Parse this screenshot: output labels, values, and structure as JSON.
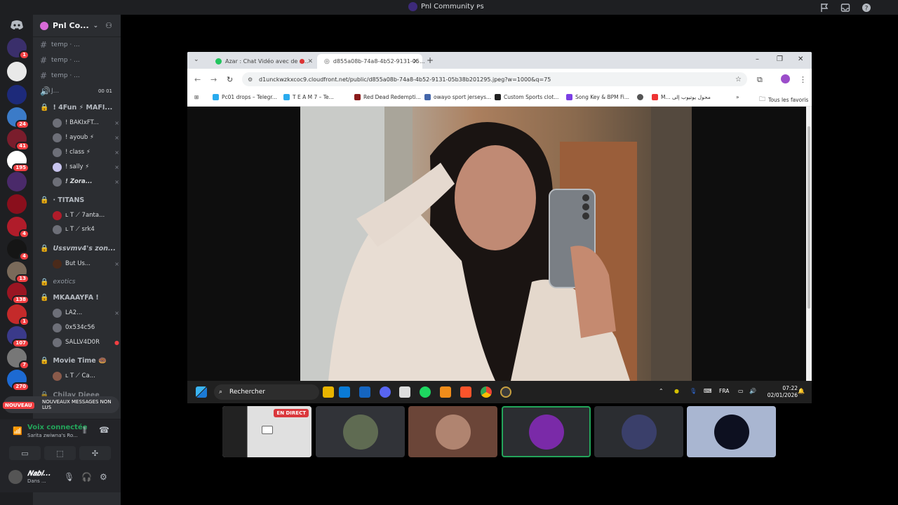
{
  "titlebar": {
    "title": "Pnl Community ᴘs"
  },
  "guild_badges": [
    "1",
    "24",
    "41",
    "195",
    "4",
    "4",
    "13",
    "138",
    "1",
    "107",
    "7",
    "270"
  ],
  "server": {
    "name": "Pnl Co..."
  },
  "channels": [
    {
      "name": "temp · ..."
    },
    {
      "name": "temp · ..."
    },
    {
      "name": "temp · ..."
    },
    {
      "name": "J...",
      "limit": "00 01"
    }
  ],
  "voice_rooms": [
    {
      "title": "! 4Fun ⚡ MAFI...",
      "users": [
        "! BAKIxFT...",
        "! ayoub ⚡",
        "! class ⚡",
        "! sally ⚡",
        "! Zora..."
      ]
    },
    {
      "title": "· TITANS",
      "users": [
        "ʟ T ⟋ 7anta...",
        "ʟ T ⟋ srk4"
      ]
    },
    {
      "title": "Ussvmv4's zon...",
      "users": [
        "But Us..."
      ]
    },
    {
      "title": "exotics",
      "users": []
    },
    {
      "title": "MKAAAYFA !",
      "users": [
        "LA2...",
        "0x534c56",
        "SALLV4D0R"
      ]
    },
    {
      "title": "Movie Time 🍩",
      "users": [
        "ʟ T ⟋ Ca..."
      ]
    },
    {
      "title": "Chilay Dieee",
      "users": []
    }
  ],
  "new_messages": {
    "badge": "NOUVEAU",
    "text": "NOUVEAUX MESSAGES NON LUS"
  },
  "voice_panel": {
    "status": "Voix connectée",
    "server": "Sarita zwiwna's Ro..."
  },
  "user_panel": {
    "name": "𝑵𝒂𝒃𝒊...",
    "status": "Dans ..."
  },
  "browser": {
    "tabs": [
      {
        "label": "Azar : Chat Vidéo avec de n..."
      },
      {
        "label": "d855a08b-74a8-4b52-9131-05..."
      }
    ],
    "url": "d1unckwzkxcoc9.cloudfront.net/public/d855a08b-74a8-4b52-9131-05b38b201295.jpeg?w=1000&q=75",
    "bookmarks": [
      "Pc01 drops – Telegr...",
      "T E A M 7 – Te...",
      "Red Dead Redempti...",
      "owayo sport jerseys...",
      "Custom Sports clot...",
      "Song Key & BPM Fi...",
      "",
      "M... محول يوتيوب إلى"
    ],
    "favorites_label": "Tous les favoris"
  },
  "taskbar": {
    "search_label": "Rechercher",
    "lang": "FRA",
    "time": "07:22",
    "date": "02/01/2026"
  },
  "stream_tiles": [
    {
      "badge": "EN DIRECT"
    }
  ]
}
